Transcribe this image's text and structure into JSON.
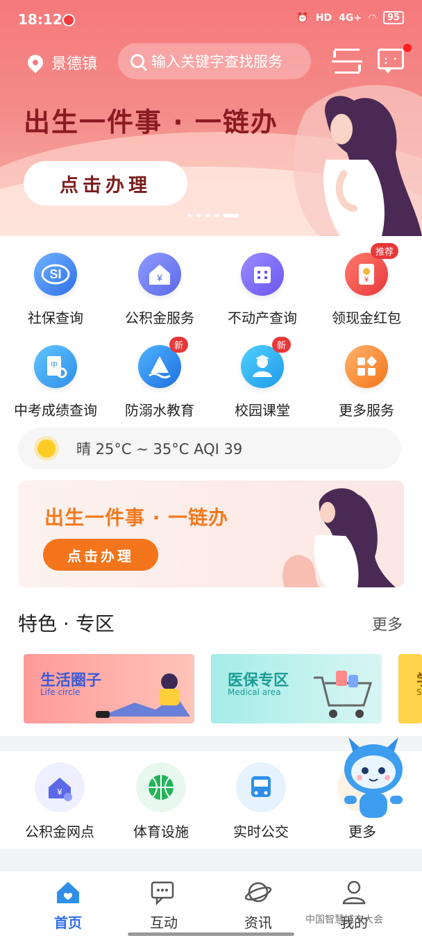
{
  "status": {
    "time": "18:12",
    "battery": "95",
    "network": "4G+",
    "hd": "HD"
  },
  "header": {
    "city": "景德镇",
    "search_placeholder": "输入关键字查找服务"
  },
  "hero": {
    "title": "出生一件事 · 一链办",
    "button": "点击办理"
  },
  "services": [
    {
      "label": "社保查询",
      "icon": "social-security-icon",
      "badge": ""
    },
    {
      "label": "公积金服务",
      "icon": "housing-fund-icon",
      "badge": ""
    },
    {
      "label": "不动产查询",
      "icon": "building-icon",
      "badge": ""
    },
    {
      "label": "领现金红包",
      "icon": "red-packet-icon",
      "badge": "推荐"
    },
    {
      "label": "中考成绩查询",
      "icon": "score-search-icon",
      "badge": ""
    },
    {
      "label": "防溺水教育",
      "icon": "swim-safety-icon",
      "badge": "新"
    },
    {
      "label": "校园课堂",
      "icon": "classroom-icon",
      "badge": "新"
    },
    {
      "label": "更多服务",
      "icon": "more-grid-icon",
      "badge": ""
    }
  ],
  "weather": {
    "text": "晴 25°C ~ 35°C AQI 39"
  },
  "banner2": {
    "title": "出生一件事 · 一链办",
    "button": "点击办理"
  },
  "feature": {
    "title": "特色 · 专区",
    "more": "更多",
    "cards": [
      {
        "cn": "生活圈子",
        "en": "Life circle"
      },
      {
        "cn": "医保专区",
        "en": "Medical area"
      },
      {
        "cn": "学",
        "en": "S"
      }
    ]
  },
  "quick": [
    {
      "label": "公积金网点"
    },
    {
      "label": "体育设施"
    },
    {
      "label": "实时公交"
    },
    {
      "label": "更多"
    }
  ],
  "tabs": [
    {
      "label": "首页"
    },
    {
      "label": "互动"
    },
    {
      "label": "资讯"
    },
    {
      "label": "我的"
    }
  ],
  "watermark": "中国智慧城市大会",
  "colors": {
    "accent": "#2f6fe8",
    "hero": "#f6797b",
    "orange": "#f4751b",
    "badge": "#e8383a"
  }
}
